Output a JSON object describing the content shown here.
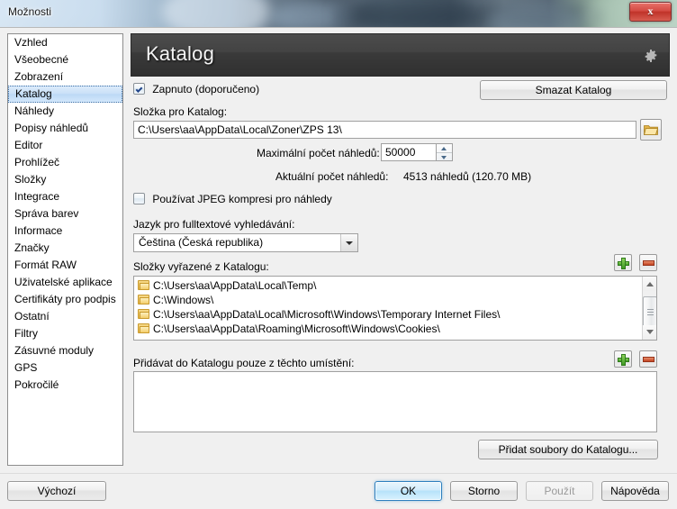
{
  "window": {
    "title": "Možnosti",
    "close_label": "x"
  },
  "sidebar": {
    "items": [
      {
        "label": "Vzhled",
        "selected": false
      },
      {
        "label": "Všeobecné",
        "selected": false
      },
      {
        "label": "Zobrazení",
        "selected": false
      },
      {
        "label": "Katalog",
        "selected": true
      },
      {
        "label": "Náhledy",
        "selected": false
      },
      {
        "label": "Popisy náhledů",
        "selected": false
      },
      {
        "label": "Editor",
        "selected": false
      },
      {
        "label": "Prohlížeč",
        "selected": false
      },
      {
        "label": "Složky",
        "selected": false
      },
      {
        "label": "Integrace",
        "selected": false
      },
      {
        "label": "Správa barev",
        "selected": false
      },
      {
        "label": "Informace",
        "selected": false
      },
      {
        "label": "Značky",
        "selected": false
      },
      {
        "label": "Formát RAW",
        "selected": false
      },
      {
        "label": "Uživatelské aplikace",
        "selected": false
      },
      {
        "label": "Certifikáty pro podpis",
        "selected": false
      },
      {
        "label": "Ostatní",
        "selected": false
      },
      {
        "label": "Filtry",
        "selected": false
      },
      {
        "label": "Zásuvné moduly",
        "selected": false
      },
      {
        "label": "GPS",
        "selected": false
      },
      {
        "label": "Pokročilé",
        "selected": false
      }
    ]
  },
  "panel": {
    "header_title": "Katalog",
    "gear_icon": "gear-icon",
    "enabled_checkbox": {
      "label": "Zapnuto (doporučeno)",
      "checked": true
    },
    "delete_catalog_button": "Smazat Katalog",
    "catalog_folder": {
      "label": "Složka pro Katalog:",
      "value": "C:\\Users\\aa\\AppData\\Local\\Zoner\\ZPS 13\\",
      "browse_icon": "folder-open-icon"
    },
    "max_thumbnails": {
      "label": "Maximální počet náhledů:",
      "value": "50000"
    },
    "current_thumbnails": {
      "label": "Aktuální počet náhledů:",
      "value": "4513 náhledů (120.70 MB)"
    },
    "jpeg_checkbox": {
      "label": "Používat JPEG kompresi pro náhledy",
      "checked": false
    },
    "fulltext_language": {
      "label": "Jazyk pro fulltextové vyhledávání:",
      "value": "Čeština (Česká republika)"
    },
    "excluded_folders": {
      "label": "Složky vyřazené z Katalogu:",
      "add_icon": "plus-icon",
      "remove_icon": "minus-icon",
      "items": [
        "C:\\Users\\aa\\AppData\\Local\\Temp\\",
        "C:\\Windows\\",
        "C:\\Users\\aa\\AppData\\Local\\Microsoft\\Windows\\Temporary Internet Files\\",
        "C:\\Users\\aa\\AppData\\Roaming\\Microsoft\\Windows\\Cookies\\"
      ]
    },
    "included_locations": {
      "label": "Přidávat do Katalogu pouze z těchto umístění:",
      "add_icon": "plus-icon",
      "remove_icon": "minus-icon",
      "items": []
    },
    "add_files_button": "Přidat soubory do Katalogu..."
  },
  "footer": {
    "defaults_button": "Výchozí",
    "ok_button": "OK",
    "cancel_button": "Storno",
    "apply_button": "Použít",
    "help_button": "Nápověda"
  }
}
